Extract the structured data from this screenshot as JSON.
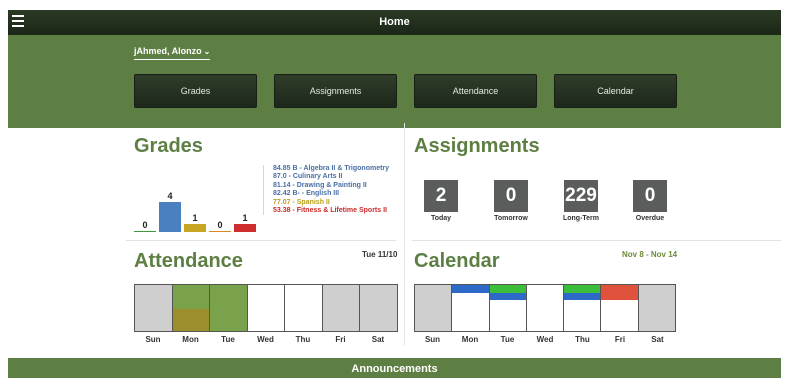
{
  "header": {
    "title": "Home"
  },
  "student": {
    "name": "jAhmed, Alonzo"
  },
  "nav": [
    "Grades",
    "Assignments",
    "Attendance",
    "Calendar"
  ],
  "grades": {
    "title": "Grades",
    "bars": [
      {
        "count": 0,
        "color": "#3b9a3b"
      },
      {
        "count": 4,
        "color": "#4a7fc0"
      },
      {
        "count": 1,
        "color": "#c9a526"
      },
      {
        "count": 0,
        "color": "#d98a1f"
      },
      {
        "count": 1,
        "color": "#cf2e2e"
      }
    ],
    "courses": [
      {
        "text": "84.85 B - Algebra II & Trigonometry",
        "color": "#4a6fa5"
      },
      {
        "text": "87.0 - Culinary Arts II",
        "color": "#4a6fa5"
      },
      {
        "text": "81.14 - Drawing & Painting II",
        "color": "#4a6fa5"
      },
      {
        "text": "82.42 B- - English III",
        "color": "#4a6fa5"
      },
      {
        "text": "77.07 - Spanish II",
        "color": "#b9a01e"
      },
      {
        "text": "53.38 - Fitness & Lifetime Sports II",
        "color": "#c92a2a"
      }
    ]
  },
  "assignments": {
    "title": "Assignments",
    "items": [
      {
        "value": "2",
        "label": "Today"
      },
      {
        "value": "0",
        "label": "Tomorrow"
      },
      {
        "value": "229",
        "label": "Long-Term"
      },
      {
        "value": "0",
        "label": "Overdue"
      }
    ]
  },
  "attendance": {
    "title": "Attendance",
    "date": "Tue 11/10",
    "days": [
      "Sun",
      "Mon",
      "Tue",
      "Wed",
      "Thu",
      "Fri",
      "Sat"
    ]
  },
  "calendar": {
    "title": "Calendar",
    "range": "Nov 8 - Nov 14",
    "days": [
      "Sun",
      "Mon",
      "Tue",
      "Wed",
      "Thu",
      "Fri",
      "Sat"
    ]
  },
  "announcements": {
    "title": "Announcements"
  },
  "colors": {
    "brand_green": "#5e7f44",
    "dark": "#1d271a"
  }
}
